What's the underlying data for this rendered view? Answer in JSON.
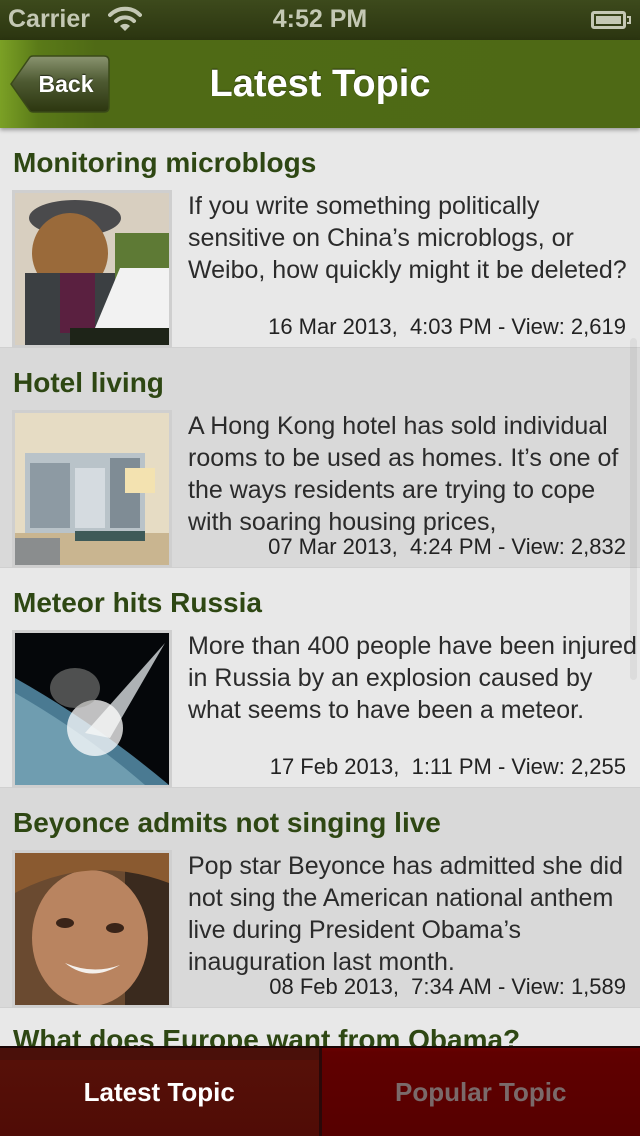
{
  "status_bar": {
    "carrier": "Carrier",
    "time": "4:52 PM",
    "wifi_icon": "wifi-icon",
    "battery_icon": "battery-icon"
  },
  "nav_bar": {
    "back_label": "Back",
    "title": "Latest Topic"
  },
  "colors": {
    "nav_green": "#4e6915",
    "title_green": "#2e4713",
    "tab_red": "#560000"
  },
  "articles": [
    {
      "title": "Monitoring microblogs",
      "description": "If you write something politically sensitive on China’s microblogs, or Weibo, how quickly might it be deleted?",
      "meta": "16 Mar 2013,  4:03 PM - View: 2,619",
      "thumbnail": "woman-with-laptop-photo"
    },
    {
      "title": "Hotel living",
      "description": "A Hong Kong hotel has sold individual rooms to be used as homes. It’s one of the ways residents are trying to cope with soaring housing prices,",
      "meta": "07 Mar 2013,  4:24 PM - View: 2,832",
      "thumbnail": "hotel-room-photo"
    },
    {
      "title": "Meteor hits Russia",
      "description": "More than 400 people have been injured in Russia by an explosion caused by what seems to have been a meteor.",
      "meta": "17 Feb 2013,  1:11 PM - View: 2,255",
      "thumbnail": "meteor-earth-photo"
    },
    {
      "title": "Beyonce admits not singing live",
      "description": "Pop star Beyonce has admitted she did not sing the American national anthem live during President Obama’s inauguration last month.",
      "meta": "08 Feb 2013,  7:34 AM - View: 1,589",
      "thumbnail": "beyonce-portrait-photo"
    },
    {
      "title": "What does Europe want from Obama?"
    }
  ],
  "tab_bar": {
    "tabs": [
      {
        "label": "Latest Topic",
        "active": true
      },
      {
        "label": "Popular Topic",
        "active": false
      }
    ]
  }
}
